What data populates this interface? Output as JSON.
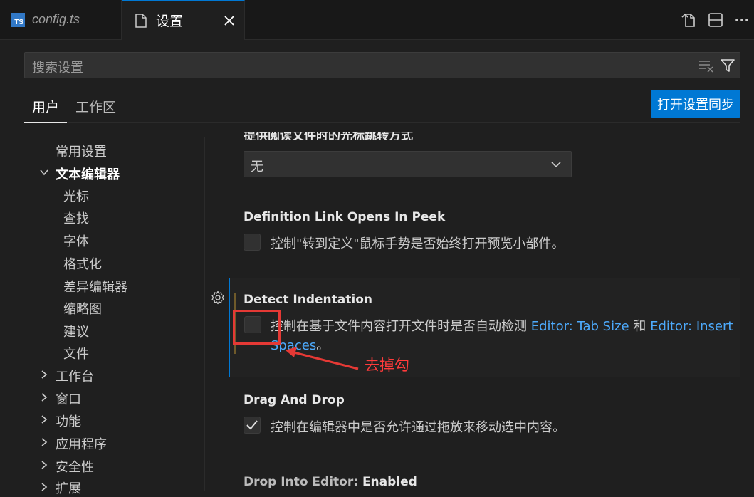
{
  "tabs": [
    {
      "icon": "ts-file-icon",
      "icon_text": "TS",
      "label": "config.ts"
    },
    {
      "icon": "file-icon",
      "label": "设置"
    }
  ],
  "toolbar_icons": [
    "open-json-icon",
    "split-editor-icon",
    "more-actions-icon"
  ],
  "search": {
    "placeholder": "搜索设置"
  },
  "scopes": {
    "user": "用户",
    "workspace": "工作区"
  },
  "sync_button": "打开设置同步",
  "toc": [
    {
      "label": "常用设置",
      "level": 0,
      "chevron": "none",
      "bold": false
    },
    {
      "label": "文本编辑器",
      "level": 0,
      "chevron": "down",
      "bold": true
    },
    {
      "label": "光标",
      "level": 1
    },
    {
      "label": "查找",
      "level": 1
    },
    {
      "label": "字体",
      "level": 1
    },
    {
      "label": "格式化",
      "level": 1
    },
    {
      "label": "差异编辑器",
      "level": 1
    },
    {
      "label": "缩略图",
      "level": 1
    },
    {
      "label": "建议",
      "level": 1
    },
    {
      "label": "文件",
      "level": 1
    },
    {
      "label": "工作台",
      "level": 0,
      "chevron": "right"
    },
    {
      "label": "窗口",
      "level": 0,
      "chevron": "right"
    },
    {
      "label": "功能",
      "level": 0,
      "chevron": "right"
    },
    {
      "label": "应用程序",
      "level": 0,
      "chevron": "right"
    },
    {
      "label": "安全性",
      "level": 0,
      "chevron": "right"
    },
    {
      "label": "扩展",
      "level": 0,
      "chevron": "right"
    }
  ],
  "settings": {
    "cut_off_title": "提供阅读文件时的光标跳转方式",
    "dropdown_value": "无",
    "definition_link": {
      "title": "Definition Link Opens In Peek",
      "desc": "控制\"转到定义\"鼠标手势是否始终打开预览小部件。",
      "checked": false
    },
    "detect_indentation": {
      "title": "Detect Indentation",
      "desc_pre": "控制在基于文件内容打开文件时是否自动检测 ",
      "link1": "Editor: Tab Size",
      "desc_mid": " 和 ",
      "link2a": "Editor: Insert",
      "link2b": "Spaces",
      "desc_end": "。",
      "checked": false
    },
    "drag_and_drop": {
      "title": "Drag And Drop",
      "desc": "控制在编辑器中是否允许通过拖放来移动选中内容。",
      "checked": true
    },
    "drop_into_editor": {
      "title_prefix": "Drop Into Editor: ",
      "title_bold": "Enabled"
    }
  },
  "annotation": {
    "text": "去掉勾",
    "color": "#ff3b3b"
  },
  "colors": {
    "accent": "#0078d4",
    "link": "#4daafc",
    "background": "#1f1f1f"
  }
}
